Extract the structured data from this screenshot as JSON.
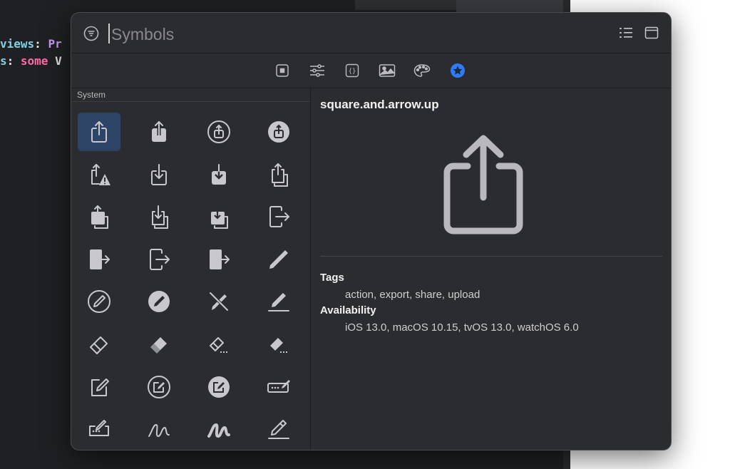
{
  "editor": {
    "line1": {
      "a": "views",
      "b": ": ",
      "c": "Pr"
    },
    "line2": {
      "a": "s",
      "b": ": ",
      "c": "some",
      "d": " V"
    }
  },
  "search": {
    "placeholder": "Symbols",
    "value": ""
  },
  "header_icons": [
    "filter-icon",
    "list-view-icon",
    "window-icon"
  ],
  "tabs": [
    {
      "icon": "views-icon",
      "active": false
    },
    {
      "icon": "modifiers-icon",
      "active": false
    },
    {
      "icon": "snippets-icon",
      "active": false
    },
    {
      "icon": "media-icon",
      "active": false
    },
    {
      "icon": "colors-icon",
      "active": false
    },
    {
      "icon": "symbols-icon",
      "active": true
    }
  ],
  "sidebar": {
    "section": "System",
    "symbols": [
      "square-and-arrow-up-icon",
      "square-and-arrow-up-fill-icon",
      "square-and-arrow-up-circle-icon",
      "square-and-arrow-up-circle-fill-icon",
      "square-and-arrow-up-trianglebadge-exclamationmark-icon",
      "square-and-arrow-down-icon",
      "square-and-arrow-down-fill-icon",
      "square-and-arrow-up-on-square-icon",
      "square-and-arrow-up-on-square-fill-icon",
      "square-and-arrow-down-on-square-icon",
      "square-and-arrow-down-on-square-fill-icon",
      "rectangle-portrait-and-arrow-right-icon",
      "rectangle-portrait-and-arrow-right-fill-icon",
      "rectangle-portrait-and-arrow-forward-icon",
      "rectangle-portrait-and-arrow-forward-fill-icon",
      "pencil-icon",
      "pencil-circle-icon",
      "pencil-circle-fill-icon",
      "pencil-slash-icon",
      "pencil-line-icon",
      "eraser-icon",
      "eraser-fill-icon",
      "eraser-line-dashed-icon",
      "eraser-line-dashed-fill-icon",
      "square-and-pencil-icon",
      "square-and-pencil-circle-icon",
      "square-and-pencil-circle-fill-icon",
      "rectangle-and-pencil-and-ellipsis-icon",
      "pencil-and-ellipsis-rectangle-icon",
      "scribble-icon",
      "scribble-variable-icon",
      "pencil-and-outline-icon"
    ],
    "selected_index": 0
  },
  "detail": {
    "name": "square.and.arrow.up",
    "preview_icon": "square-and-arrow-up-icon",
    "tags_label": "Tags",
    "tags": "action, export, share, upload",
    "availability_label": "Availability",
    "availability": "iOS 13.0, macOS 10.15, tvOS 13.0, watchOS 6.0"
  },
  "colors": {
    "panel_bg": "#2b2c2f",
    "accent": "#2f7cf6",
    "selection": "#2d4466",
    "icon": "#c8c8cc"
  }
}
